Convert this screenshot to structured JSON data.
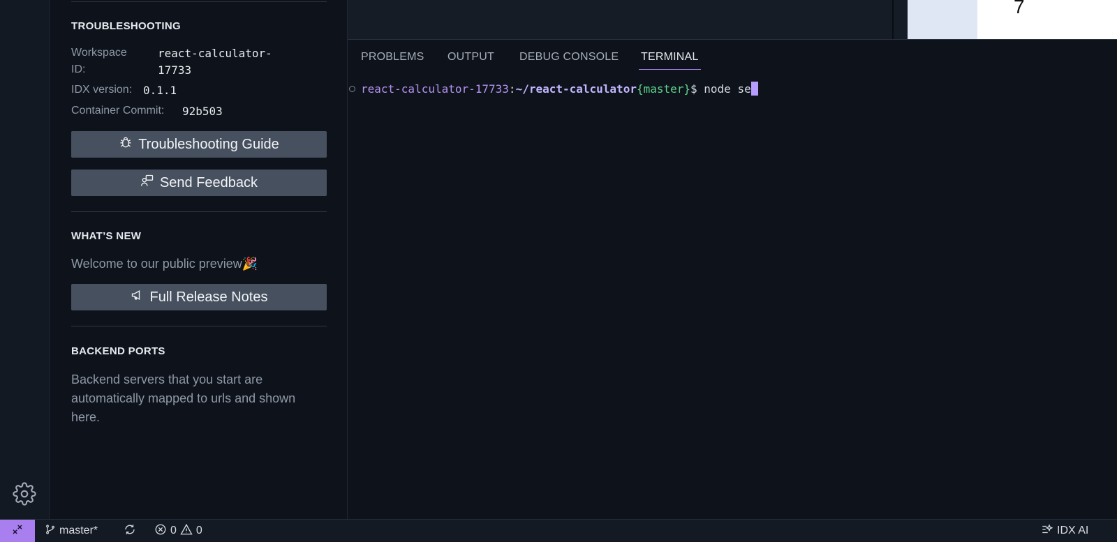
{
  "troubleshooting": {
    "title": "TROUBLESHOOTING",
    "workspace_label_line1": "Workspace",
    "workspace_label_line2": "ID:",
    "workspace_value_line1": "react-calculator-",
    "workspace_value_line2": "17733",
    "idx_version_label": "IDX version:",
    "idx_version_value": "0.1.1",
    "container_commit_label": "Container Commit:",
    "container_commit_value": "92b503",
    "guide_button": "Troubleshooting Guide",
    "feedback_button": "Send Feedback"
  },
  "whats_new": {
    "title": "WHAT’S NEW",
    "message": "Welcome to our public preview🎉",
    "release_notes_button": "Full Release Notes"
  },
  "backend_ports": {
    "title": "BACKEND PORTS",
    "description": "Backend servers that you start are automatically mapped to urls and shown here."
  },
  "preview": {
    "visible_char": "7"
  },
  "panel_tabs": [
    "PROBLEMS",
    "OUTPUT",
    "DEBUG CONSOLE",
    "TERMINAL"
  ],
  "terminal": {
    "host": "react-calculator-17733",
    "colon": ":",
    "path": "~/react-calculator",
    "branch": "{master}",
    "prompt": "$ ",
    "command": "node se"
  },
  "status_bar": {
    "branch": "master*",
    "errors": "0",
    "warnings": "0",
    "ai_label": "IDX AI"
  },
  "colors": {
    "accent": "#a97ff0",
    "button_bg": "#46505e",
    "terminal_host": "#b392f0",
    "terminal_branch": "#5fd38d"
  },
  "icons": [
    "gear-icon",
    "bug-icon",
    "feedback-icon",
    "megaphone-icon",
    "remote-icon",
    "git-branch-icon",
    "sync-icon",
    "error-icon",
    "warning-icon",
    "ai-icon"
  ]
}
